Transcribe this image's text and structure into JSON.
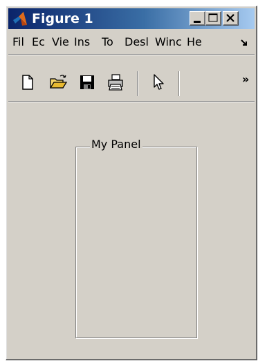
{
  "window": {
    "title": "Figure 1"
  },
  "menubar": {
    "items": [
      "Fil",
      "Ec",
      "Vie",
      "Ins",
      "To",
      "Desl",
      "Winc",
      "He"
    ],
    "overflow_icon": "chevron-down-right-icon"
  },
  "toolbar": {
    "tools": [
      {
        "name": "new-figure",
        "icon": "new-document-icon"
      },
      {
        "name": "open-file",
        "icon": "open-folder-icon"
      },
      {
        "name": "save-figure",
        "icon": "floppy-disk-icon"
      },
      {
        "name": "print-figure",
        "icon": "printer-icon"
      },
      {
        "name": "edit-plot",
        "icon": "arrow-pointer-icon"
      }
    ],
    "overflow_label": "»"
  },
  "panel": {
    "title": "My Panel"
  },
  "colors": {
    "face": "#d4d0c8",
    "title_gradient_start": "#0a246a",
    "title_gradient_end": "#a6caf0"
  }
}
